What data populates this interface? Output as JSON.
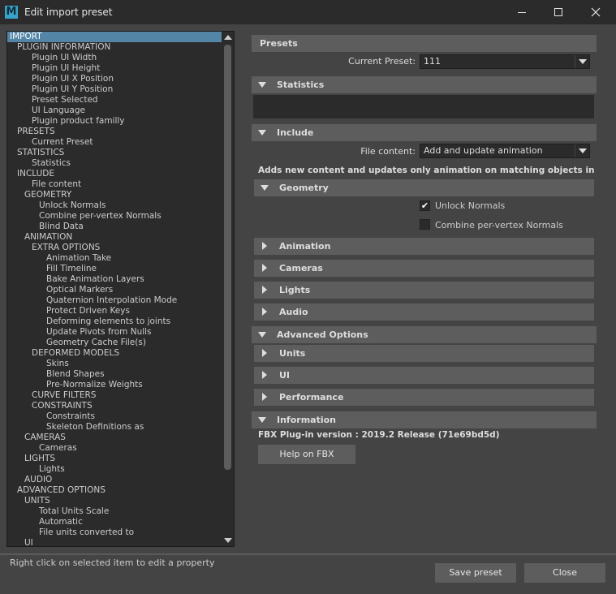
{
  "window": {
    "title": "Edit import preset",
    "app_icon_letter": "M",
    "app_icon": "maya-icon",
    "controls": [
      "minimize-icon",
      "maximize-icon",
      "close-icon"
    ]
  },
  "tree": {
    "items": [
      {
        "label": "IMPORT",
        "level": 0,
        "selected": true
      },
      {
        "label": "PLUGIN INFORMATION",
        "level": 1
      },
      {
        "label": "Plugin UI Width",
        "level": 3
      },
      {
        "label": "Plugin UI Height",
        "level": 3
      },
      {
        "label": "Plugin UI X Position",
        "level": 3
      },
      {
        "label": "Plugin UI Y Position",
        "level": 3
      },
      {
        "label": "Preset Selected",
        "level": 3
      },
      {
        "label": "UI Language",
        "level": 3
      },
      {
        "label": "Plugin product familly",
        "level": 3
      },
      {
        "label": "PRESETS",
        "level": 1
      },
      {
        "label": "Current Preset",
        "level": 3
      },
      {
        "label": "STATISTICS",
        "level": 1
      },
      {
        "label": "Statistics",
        "level": 3
      },
      {
        "label": "INCLUDE",
        "level": 1
      },
      {
        "label": "File content",
        "level": 3
      },
      {
        "label": "GEOMETRY",
        "level": 2
      },
      {
        "label": "Unlock Normals",
        "level": 4
      },
      {
        "label": "Combine per-vertex Normals",
        "level": 4
      },
      {
        "label": "Blind Data",
        "level": 4
      },
      {
        "label": "ANIMATION",
        "level": 2
      },
      {
        "label": "EXTRA OPTIONS",
        "level": 3
      },
      {
        "label": "Animation Take",
        "level": 5
      },
      {
        "label": "Fill Timeline",
        "level": 5
      },
      {
        "label": "Bake Animation Layers",
        "level": 5
      },
      {
        "label": "Optical Markers",
        "level": 5
      },
      {
        "label": "Quaternion Interpolation Mode",
        "level": 5
      },
      {
        "label": "Protect Driven Keys",
        "level": 5
      },
      {
        "label": "Deforming elements to joints",
        "level": 5
      },
      {
        "label": "Update Pivots from Nulls",
        "level": 5
      },
      {
        "label": "Geometry Cache File(s)",
        "level": 5
      },
      {
        "label": "DEFORMED MODELS",
        "level": 3
      },
      {
        "label": "Skins",
        "level": 5
      },
      {
        "label": "Blend Shapes",
        "level": 5
      },
      {
        "label": "Pre-Normalize Weights",
        "level": 5
      },
      {
        "label": "CURVE FILTERS",
        "level": 3
      },
      {
        "label": "CONSTRAINTS",
        "level": 3
      },
      {
        "label": "Constraints",
        "level": 5
      },
      {
        "label": "Skeleton Definitions as",
        "level": 5
      },
      {
        "label": "CAMERAS",
        "level": 2
      },
      {
        "label": "Cameras",
        "level": 4
      },
      {
        "label": "LIGHTS",
        "level": 2
      },
      {
        "label": "Lights",
        "level": 4
      },
      {
        "label": "AUDIO",
        "level": 2
      },
      {
        "label": "ADVANCED OPTIONS",
        "level": 1
      },
      {
        "label": "UNITS",
        "level": 2
      },
      {
        "label": "Total Units Scale",
        "level": 4
      },
      {
        "label": "Automatic",
        "level": 4
      },
      {
        "label": "File units converted to",
        "level": 4
      },
      {
        "label": "UI",
        "level": 2
      }
    ]
  },
  "presets": {
    "header": "Presets",
    "current_preset_label": "Current Preset:",
    "current_preset_value": "111"
  },
  "statistics": {
    "header": "Statistics"
  },
  "include": {
    "header": "Include",
    "file_content_label": "File content:",
    "file_content_value": "Add and update animation",
    "description": "Adds new content and updates only animation on matching objects in the scene"
  },
  "geometry": {
    "header": "Geometry",
    "unlock_normals_label": "Unlock Normals",
    "unlock_normals_checked": true,
    "combine_normals_label": "Combine per-vertex Normals",
    "combine_normals_checked": false
  },
  "collapsed": {
    "animation": "Animation",
    "cameras": "Cameras",
    "lights": "Lights",
    "audio": "Audio"
  },
  "advanced": {
    "header": "Advanced Options",
    "units": "Units",
    "ui": "UI",
    "performance": "Performance"
  },
  "information": {
    "header": "Information",
    "version_text": "FBX Plug-in version :  2019.2 Release (71e69bd5d)",
    "help_button": "Help on FBX"
  },
  "footer": {
    "status": "Right click on selected item to edit a property",
    "save_button": "Save preset",
    "close_button": "Close",
    "check_mark": "✔"
  }
}
